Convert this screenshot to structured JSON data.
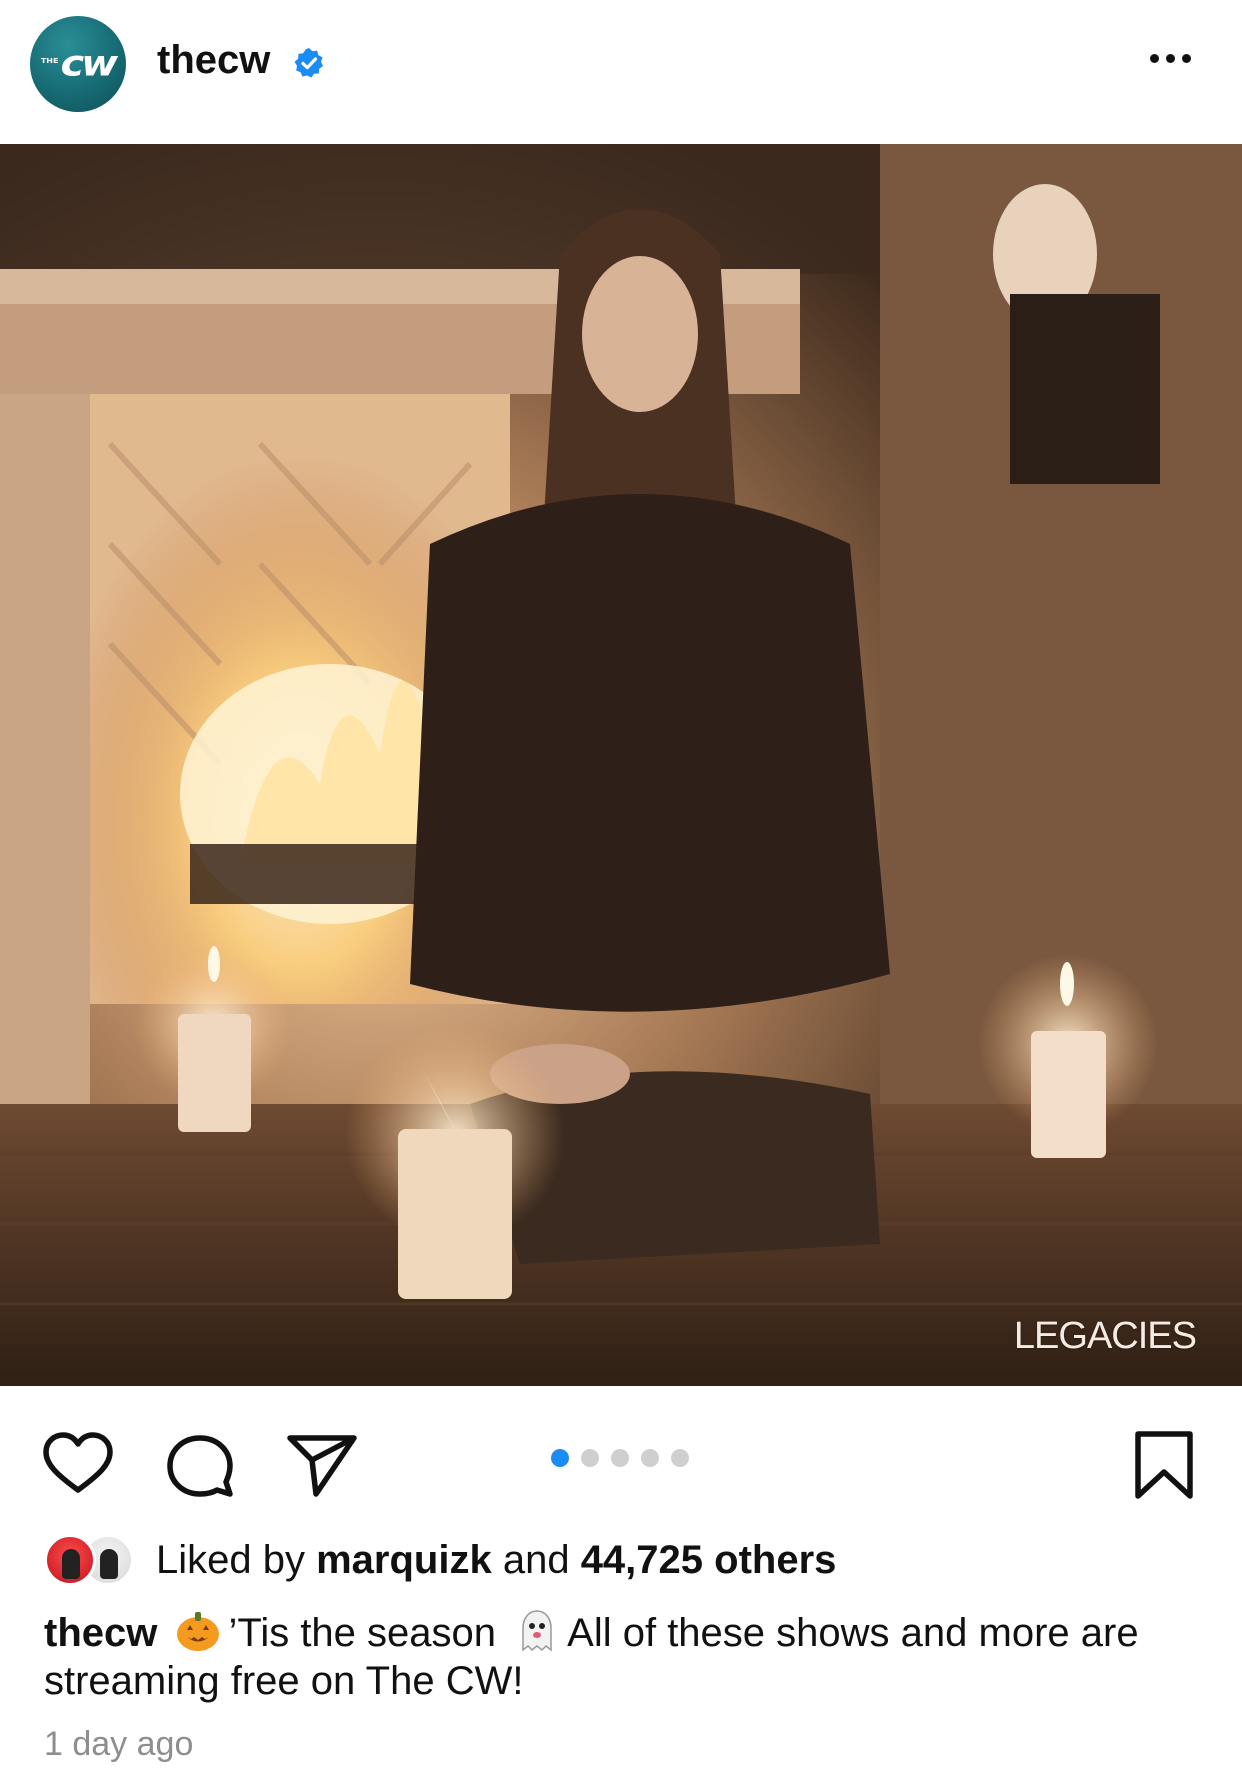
{
  "header": {
    "avatar_mark": "cw",
    "avatar_small": "THE",
    "username": "thecw",
    "verified_color": "#1a8cf3"
  },
  "post": {
    "image_description_icon": "photo",
    "overlay_text": "LEGACIES",
    "carousel": {
      "count": 5,
      "active_index": 0
    }
  },
  "actions": {
    "like_icon": "heart-icon",
    "comment_icon": "comment-icon",
    "share_icon": "share-icon",
    "save_icon": "bookmark-icon"
  },
  "likes": {
    "prefix": "Liked by ",
    "user": "marquizk",
    "middle": " and ",
    "count": "44,725 others"
  },
  "caption": {
    "username": "thecw",
    "text_1": "’Tis the season",
    "text_2": "All of these shows and more are streaming free on The CW!"
  },
  "timestamp": "1 day ago"
}
